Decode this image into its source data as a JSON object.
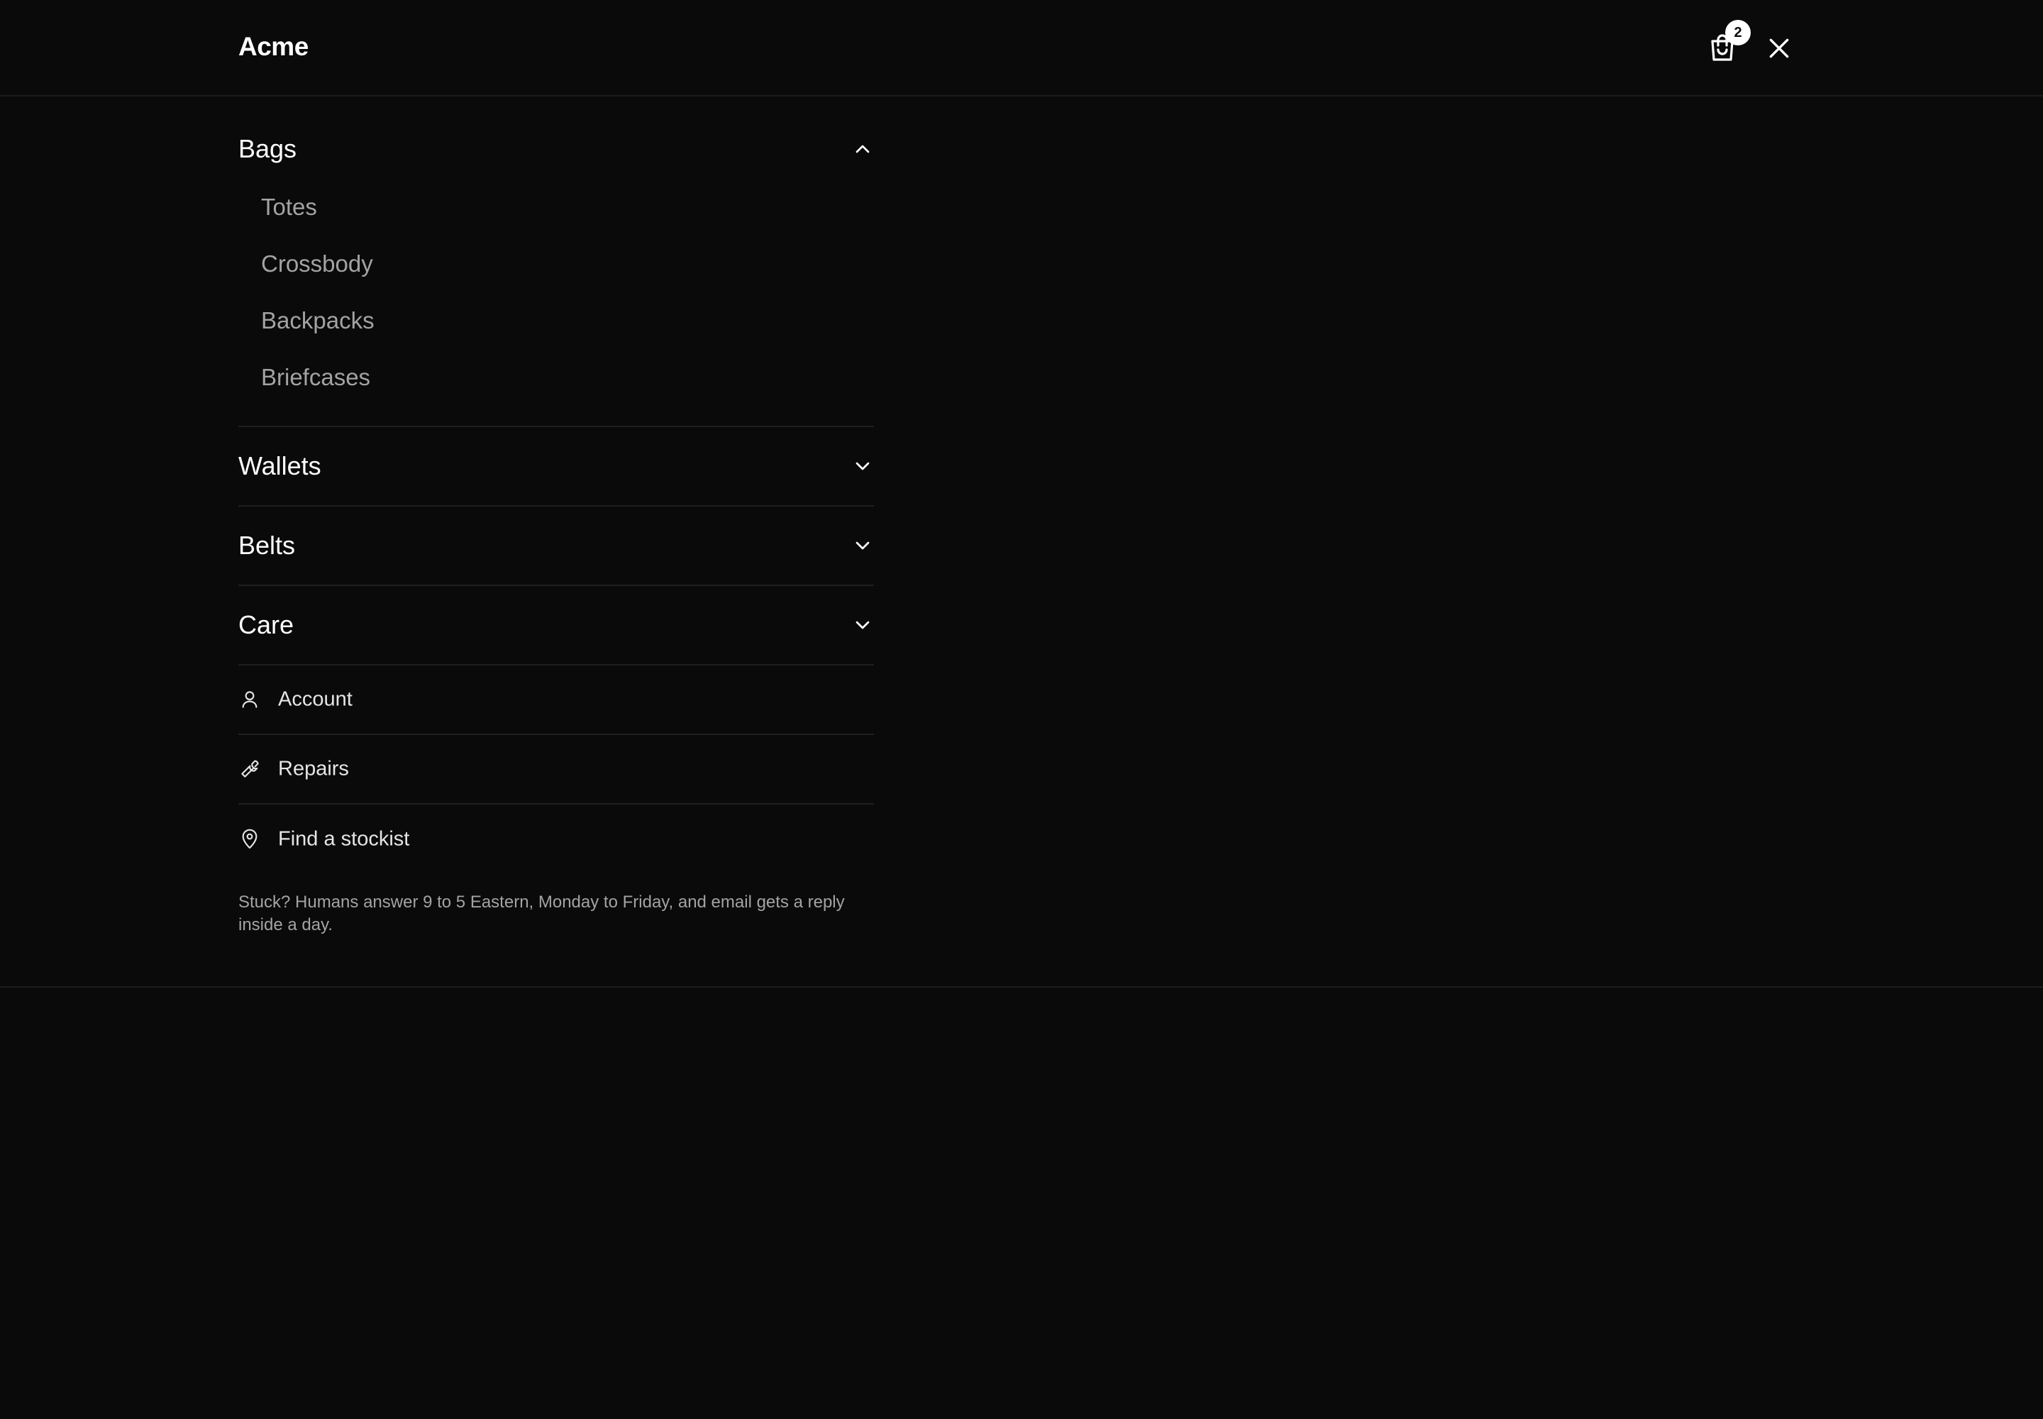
{
  "header": {
    "brand": "Acme",
    "cart_count": "2",
    "cart_icon": "shopping-bag-icon",
    "close_icon": "close-icon"
  },
  "menu": {
    "categories": [
      {
        "label": "Bags",
        "expanded": true,
        "items": [
          "Totes",
          "Crossbody",
          "Backpacks",
          "Briefcases"
        ]
      },
      {
        "label": "Wallets",
        "expanded": false
      },
      {
        "label": "Belts",
        "expanded": false
      },
      {
        "label": "Care",
        "expanded": false
      }
    ],
    "utility": [
      {
        "label": "Account",
        "icon": "user-icon"
      },
      {
        "label": "Repairs",
        "icon": "wrench-icon"
      },
      {
        "label": "Find a stockist",
        "icon": "map-pin-icon"
      }
    ],
    "help_text": "Stuck? Humans answer 9 to 5 Eastern, Monday to Friday, and email gets a reply inside a day."
  },
  "colors": {
    "background": "#0a0a0a",
    "text": "#ffffff",
    "muted": "#a3a3a3",
    "divider": "#1f1f1f"
  }
}
